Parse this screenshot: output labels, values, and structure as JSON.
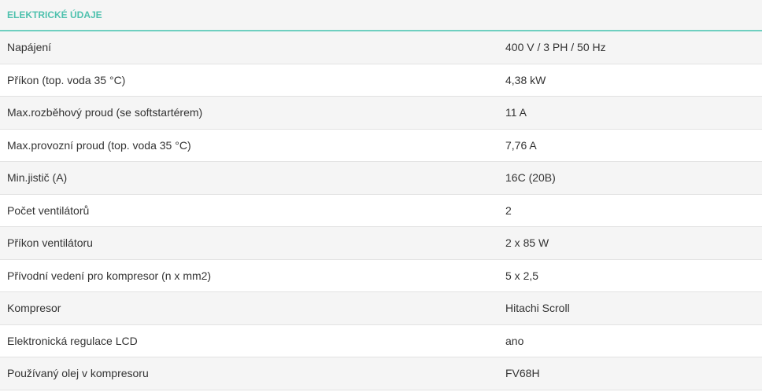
{
  "section": {
    "title": "ELEKTRICKÉ ÚDAJE"
  },
  "rows": [
    {
      "label": "Napájení",
      "value": "400 V / 3 PH / 50 Hz"
    },
    {
      "label": "Příkon (top. voda 35 °C)",
      "value": "4,38 kW"
    },
    {
      "label": "Max.rozběhový proud (se softstartérem)",
      "value": "11 A"
    },
    {
      "label": "Max.provozní proud (top. voda 35 °C)",
      "value": "7,76 A"
    },
    {
      "label": "Min.jistič (A)",
      "value": "16C (20B)"
    },
    {
      "label": "Počet ventilátorů",
      "value": "2"
    },
    {
      "label": "Příkon ventilátoru",
      "value": "2 x 85 W"
    },
    {
      "label": "Přívodní vedení pro kompresor (n x mm2)",
      "value": "5 x 2,5"
    },
    {
      "label": "Kompresor",
      "value": "Hitachi Scroll"
    },
    {
      "label": "Elektronická regulace LCD",
      "value": "ano"
    },
    {
      "label": "Používaný olej v kompresoru",
      "value": "FV68H"
    }
  ],
  "colors": {
    "accent": "#4fc1ae",
    "header_border": "#6fcfc0",
    "row_odd": "#f5f5f5",
    "row_even": "#ffffff",
    "text": "#333333"
  }
}
